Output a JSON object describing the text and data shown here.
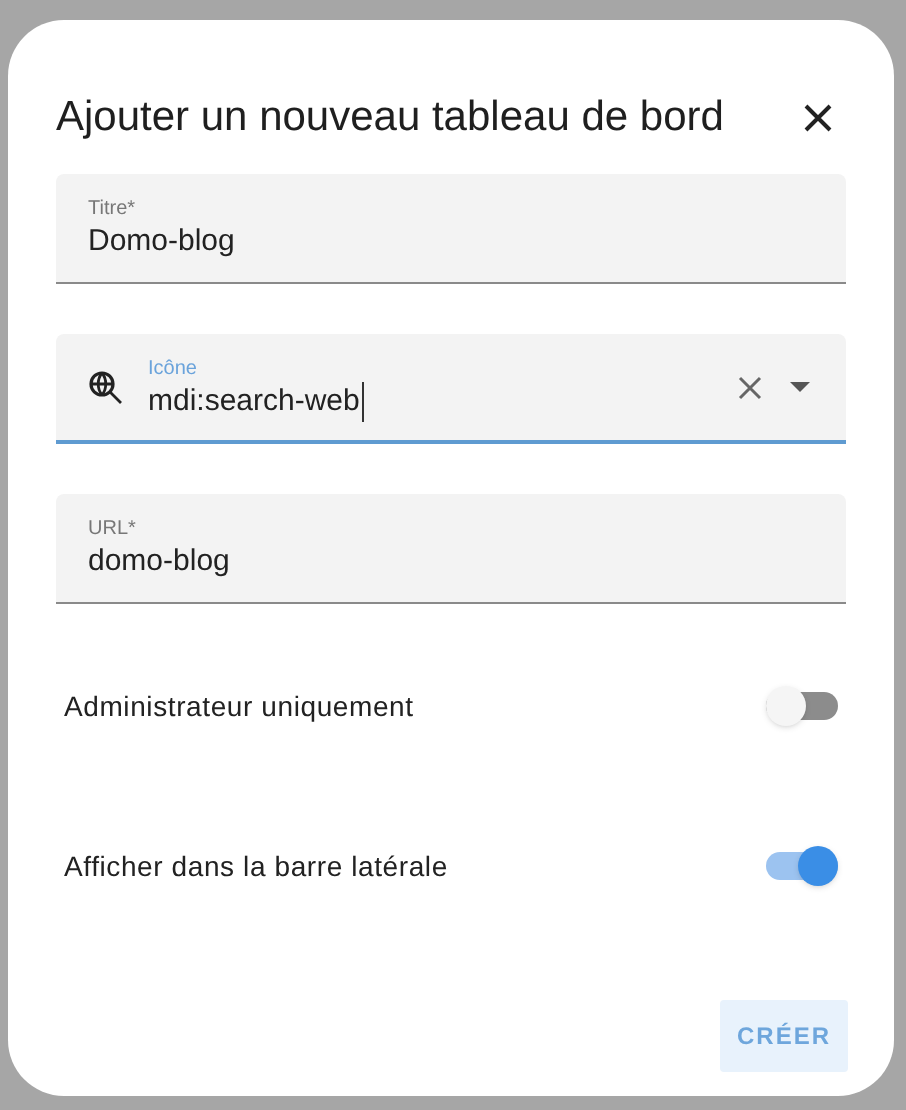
{
  "dialog": {
    "title": "Ajouter un nouveau tableau de bord"
  },
  "fields": [
    {
      "kind": "text",
      "label": "Titre*",
      "value": "Domo-blog",
      "focused": false
    },
    {
      "kind": "icon-picker",
      "label": "Icône",
      "value": "mdi:search-web",
      "focused": true
    },
    {
      "kind": "text",
      "label": "URL*",
      "value": "domo-blog",
      "focused": false
    }
  ],
  "toggles": [
    {
      "label": "Administrateur uniquement",
      "on": false
    },
    {
      "label": "Afficher dans la barre latérale",
      "on": true
    }
  ],
  "create_button": {
    "label": "CRÉER",
    "disabled": true
  }
}
